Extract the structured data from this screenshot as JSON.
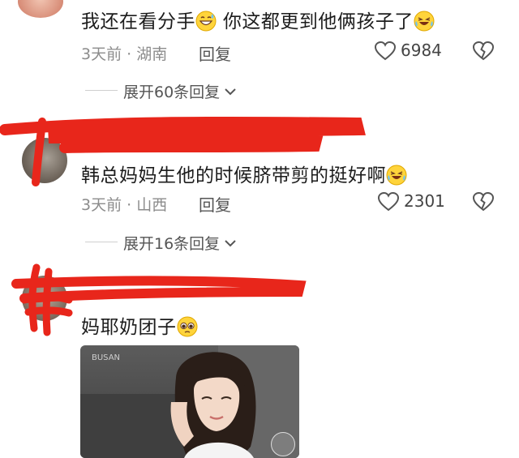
{
  "comments": [
    {
      "text": "我还在看分手",
      "text_tail": "你这都更到他俩孩子了",
      "time": "3天前",
      "location": "湖南",
      "reply_label": "回复",
      "likes": "6984",
      "expand_label": "展开60条回复"
    },
    {
      "username": "",
      "text": "韩总妈妈生他的时候脐带剪的挺好啊",
      "time": "3天前",
      "location": "山西",
      "reply_label": "回复",
      "likes": "2301",
      "expand_label": "展开16条回复"
    },
    {
      "username": "",
      "text": "妈耶奶团子",
      "image_watermark": "BUSAN"
    }
  ],
  "colors": {
    "scribble": "#e8261b",
    "meta_text": "#8c8c8c"
  }
}
